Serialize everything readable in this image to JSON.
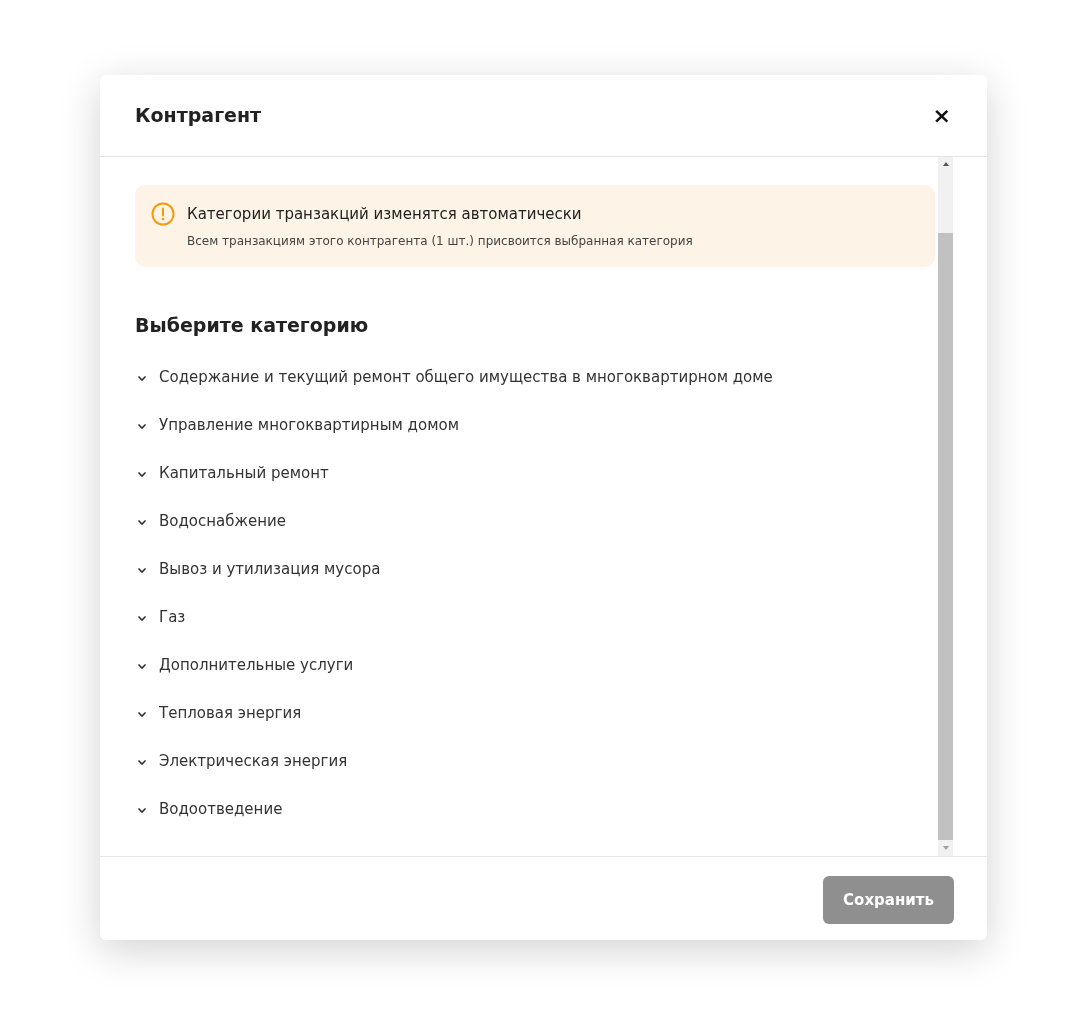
{
  "dialog": {
    "title": "Контрагент",
    "close": "×"
  },
  "alert": {
    "title": "Категории транзакций изменятся автоматически",
    "text": "Всем транзакциям этого контрагента (1 шт.) присвоится выбранная категория"
  },
  "section_title": "Выберите категорию",
  "categories": [
    {
      "label": "Содержание и текущий ремонт общего имущества в многоквартирном доме",
      "expanded": false
    },
    {
      "label": "Управление многоквартирным домом",
      "expanded": false
    },
    {
      "label": "Капитальный ремонт",
      "expanded": false
    },
    {
      "label": "Водоснабжение",
      "expanded": false
    },
    {
      "label": "Вывоз и утилизация мусора",
      "expanded": false
    },
    {
      "label": "Газ",
      "expanded": false
    },
    {
      "label": "Дополнительные услуги",
      "expanded": false
    },
    {
      "label": "Тепловая энергия",
      "expanded": false
    },
    {
      "label": "Электрическая энергия",
      "expanded": false
    },
    {
      "label": "Водоотведение",
      "expanded": false
    }
  ],
  "save_button": {
    "label": "Сохранить",
    "disabled": true
  }
}
